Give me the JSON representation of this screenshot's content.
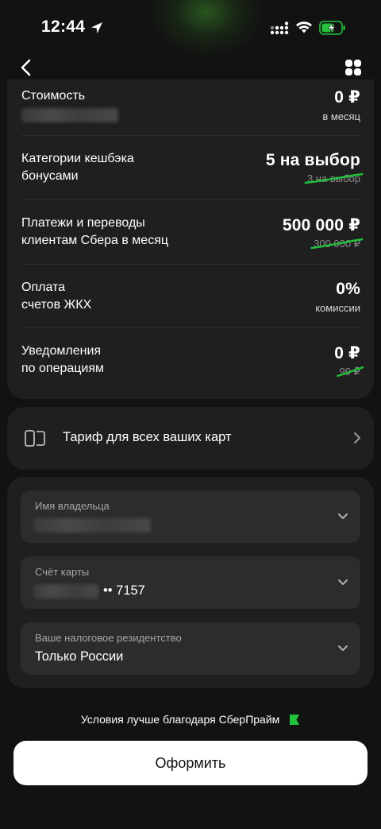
{
  "status_bar": {
    "time": "12:44"
  },
  "navigation": {
    "back_icon": "chevron-left-icon",
    "menu_icon": "grid-icon"
  },
  "tariff": {
    "rows": [
      {
        "label_lines": [
          "Стоимость"
        ],
        "value": "0 ₽",
        "subtext": "в месяц",
        "old_value": ""
      },
      {
        "label_lines": [
          "Категории кешбэка",
          "бонусами"
        ],
        "value": "5 на выбор",
        "subtext": "",
        "old_value": "3 на выбор"
      },
      {
        "label_lines": [
          "Платежи и переводы",
          "клиентам Сбера в месяц"
        ],
        "value": "500 000 ₽",
        "subtext": "",
        "old_value": "300 000 ₽"
      },
      {
        "label_lines": [
          "Оплата",
          "счетов ЖКХ"
        ],
        "value": "0%",
        "subtext": "комиссии",
        "old_value": ""
      },
      {
        "label_lines": [
          "Уведомления",
          "по операциям"
        ],
        "value": "0 ₽",
        "subtext": "",
        "old_value": "99 ₽"
      }
    ]
  },
  "all_cards_link": {
    "label": "Тариф для всех ваших карт",
    "icon": "cards-icon"
  },
  "form": {
    "owner": {
      "label": "Имя владельца",
      "value": ""
    },
    "account": {
      "label": "Счёт карты",
      "value": "•• 7157"
    },
    "residency": {
      "label": "Ваше налоговое резидентство",
      "value": "Только России"
    }
  },
  "promo_text": "Условия лучше благодаря СберПрайм",
  "submit_label": "Оформить",
  "colors": {
    "background": "#121212",
    "card": "#1f1f1f",
    "field": "#2c2c2c",
    "accent_green": "#21c23c",
    "button": "#ffffff"
  }
}
